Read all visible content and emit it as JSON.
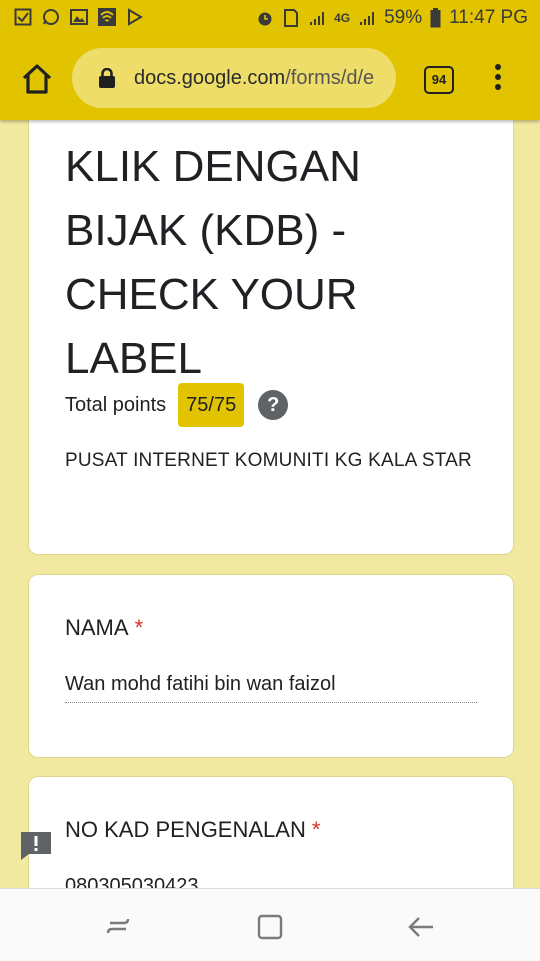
{
  "status_bar": {
    "battery": "59%",
    "time": "11:47 PG",
    "network": "4G"
  },
  "browser": {
    "url_domain": "docs.google.com",
    "url_path": "/forms/d/e",
    "tab_count": "94"
  },
  "form": {
    "title": "KLIK DENGAN BIJAK (KDB) - CHECK YOUR LABEL",
    "points_label": "Total points",
    "points_value": "75/75",
    "help": "?",
    "description": "PUSAT INTERNET KOMUNITI KG KALA STAR"
  },
  "questions": [
    {
      "label": "NAMA",
      "required": "*",
      "answer": "Wan mohd fatihi bin wan faizol"
    },
    {
      "label": "NO KAD PENGENALAN",
      "required": "*",
      "answer": "080305030423"
    }
  ],
  "colors": {
    "accent": "#e2c300",
    "background": "#f2e9a0",
    "required": "#d93025"
  },
  "icons": [
    "home-icon",
    "lock-icon",
    "tab-switcher-icon",
    "more-vert-icon",
    "feedback-icon",
    "recents-icon",
    "overview-icon",
    "back-icon"
  ]
}
